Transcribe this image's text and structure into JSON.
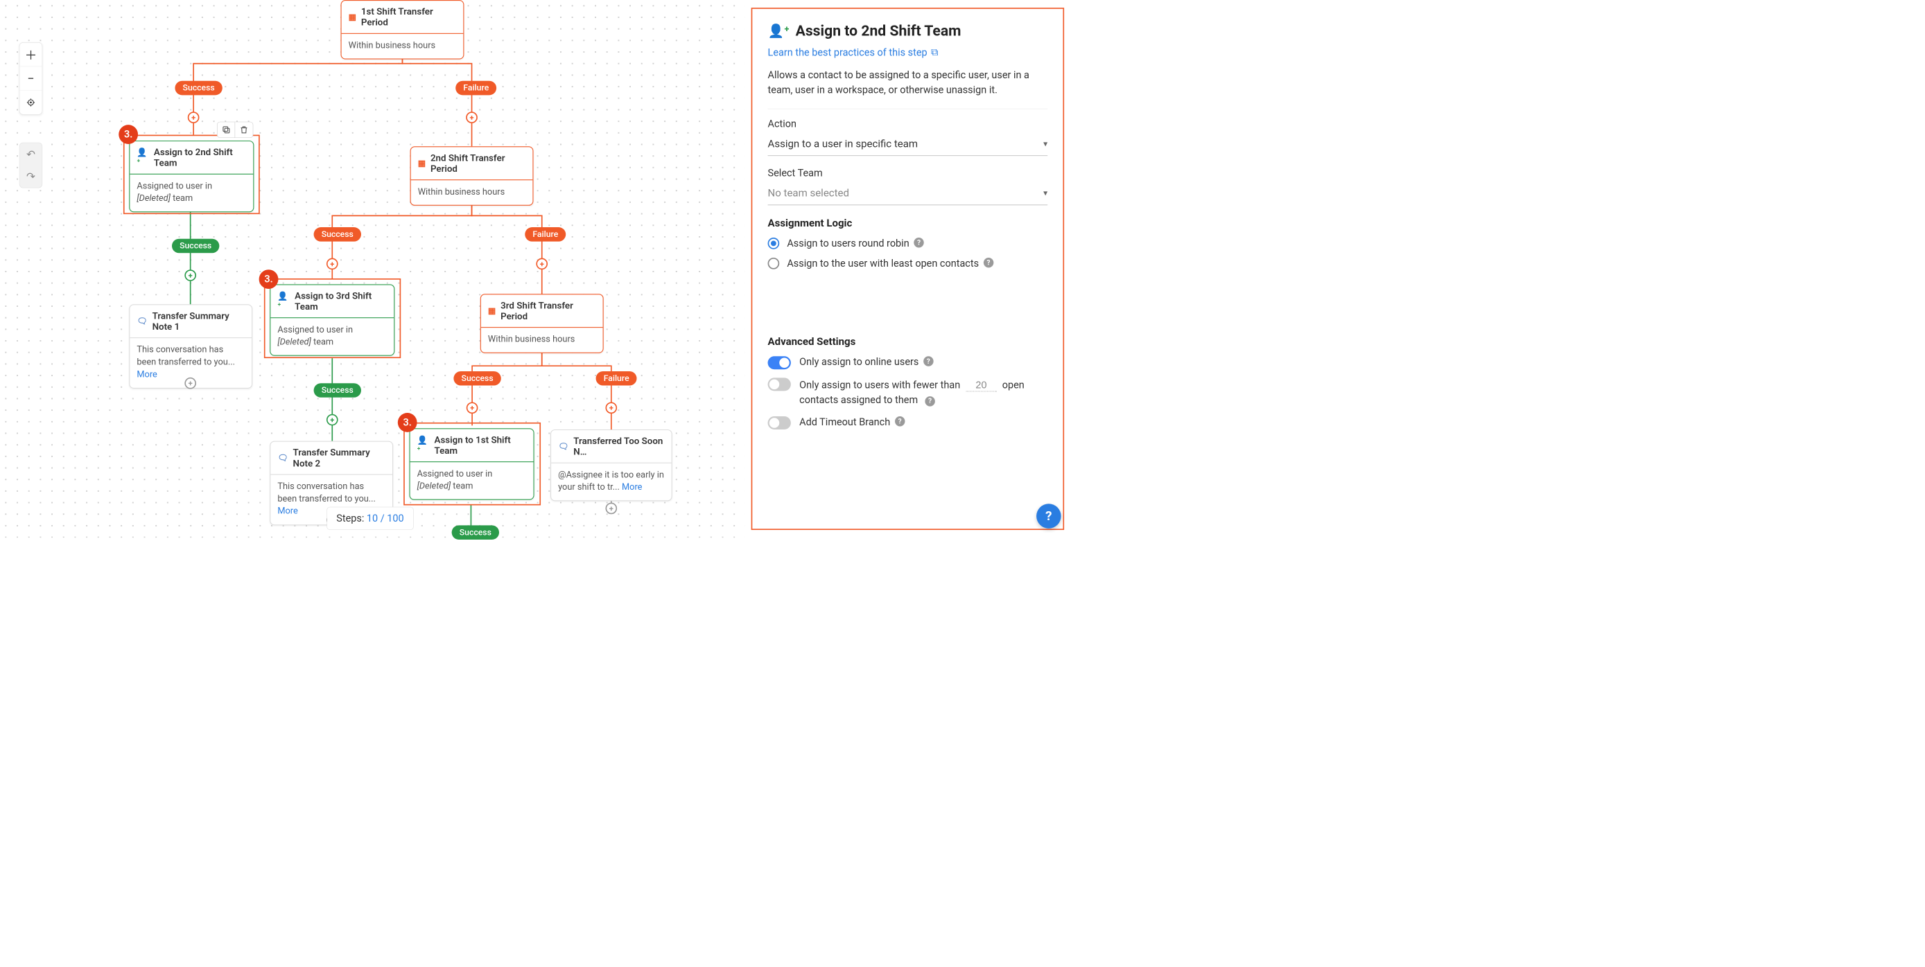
{
  "canvas": {
    "nodes": {
      "shift1": {
        "title": "1st Shift Transfer Period",
        "body": "Within business hours"
      },
      "assign2nd": {
        "title": "Assign to 2nd Shift Team",
        "body_prefix": "Assigned to user in ",
        "deleted": "[Deleted]",
        "body_suffix": " team"
      },
      "shift2": {
        "title": "2nd Shift Transfer Period",
        "body": "Within business hours"
      },
      "assign3rd": {
        "title": "Assign to 3rd Shift Team",
        "body_prefix": "Assigned to user in ",
        "deleted": "[Deleted]",
        "body_suffix": " team"
      },
      "shift3": {
        "title": "3rd Shift Transfer Period",
        "body": "Within business hours"
      },
      "note1": {
        "title": "Transfer Summary Note 1",
        "body": "This conversation has been transferred to you... ",
        "more": "More"
      },
      "note2": {
        "title": "Transfer Summary Note 2",
        "body": "This conversation has been transferred to you... ",
        "more": "More"
      },
      "assign1st": {
        "title": "Assign to 1st Shift Team",
        "body_prefix": "Assigned to user in ",
        "deleted": "[Deleted]",
        "body_suffix": " team"
      },
      "tooSoon": {
        "title": "Transferred Too Soon N…",
        "body": "@Assignee it is too early in your shift to tr... ",
        "more": "More"
      }
    },
    "pills": {
      "success": "Success",
      "failure": "Failure"
    },
    "step_badge": "3.",
    "steps_counter": {
      "label": "Steps:",
      "current": "10",
      "sep": "/",
      "total": "100"
    }
  },
  "panel": {
    "title": "Assign to 2nd Shift Team",
    "learn_link": "Learn the best practices of this step",
    "description": "Allows a contact to be assigned to a specific user, user in a team, user in a workspace, or otherwise unassign it.",
    "action": {
      "label": "Action",
      "value": "Assign to a user in specific team"
    },
    "team": {
      "label": "Select Team",
      "placeholder": "No team selected"
    },
    "logic": {
      "heading": "Assignment Logic",
      "opt_round_robin": "Assign to users round robin",
      "opt_least_open": "Assign to the user with least open contacts"
    },
    "advanced": {
      "heading": "Advanced Settings",
      "only_online": "Only assign to online users",
      "fewer_than_pre": "Only assign to users with fewer than",
      "fewer_than_value": "20",
      "fewer_than_post": "open contacts assigned to them",
      "timeout": "Add Timeout Branch"
    }
  }
}
